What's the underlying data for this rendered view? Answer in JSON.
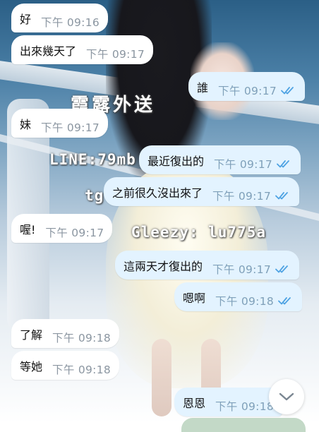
{
  "watermark": {
    "brand": "霞露外送",
    "line": "LINE:79mb",
    "tg": "tg",
    "gleezy": "Gleezy: lu775a"
  },
  "messages": [
    {
      "dir": "in",
      "text": "好",
      "time": "下午 09:16"
    },
    {
      "dir": "in",
      "text": "出來幾天了",
      "time": "下午 09:17"
    },
    {
      "dir": "out",
      "text": "誰",
      "time": "下午 09:17",
      "status": "read"
    },
    {
      "dir": "in",
      "text": "妹",
      "time": "下午 09:17"
    },
    {
      "dir": "out",
      "text": "最近復出的",
      "time": "下午 09:17",
      "status": "read"
    },
    {
      "dir": "out",
      "text": "之前很久沒出來了",
      "time": "下午 09:17",
      "status": "read"
    },
    {
      "dir": "in",
      "text": "喔!",
      "time": "下午 09:17"
    },
    {
      "dir": "out",
      "text": "這兩天才復出的",
      "time": "下午 09:17",
      "status": "read"
    },
    {
      "dir": "out",
      "text": "嗯啊",
      "time": "下午 09:18",
      "status": "read"
    },
    {
      "dir": "in",
      "text": "了解",
      "time": "下午 09:18"
    },
    {
      "dir": "in",
      "text": "等她",
      "time": "下午 09:18"
    },
    {
      "dir": "out",
      "text": "恩恩",
      "time": "下午 09:18"
    }
  ],
  "icons": {
    "read_receipt": "double-check-icon",
    "scroll_down": "chevron-down-icon"
  },
  "colors": {
    "incoming_bubble": "#ffffff",
    "outgoing_bubble": "#e3f3ff",
    "check": "#4fa3e3",
    "time": "#8b96a1"
  }
}
